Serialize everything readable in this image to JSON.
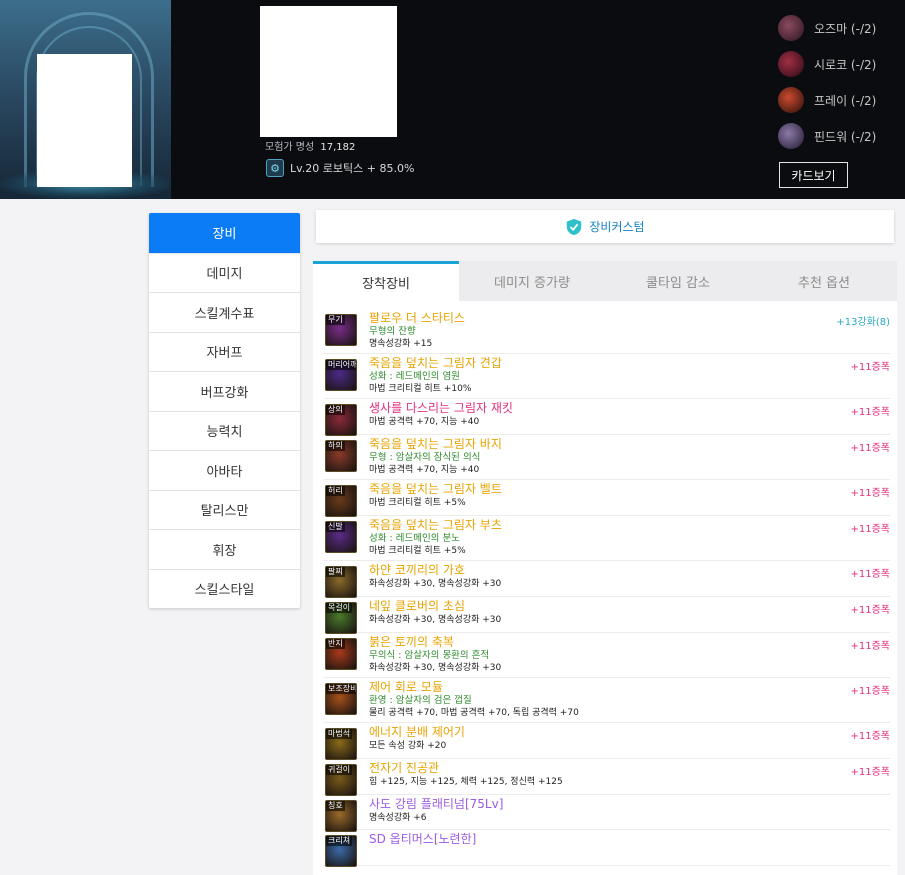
{
  "header": {
    "fame_label": "모험가 명성",
    "fame_value": "17,182",
    "guild_text": "Lv.20 로보틱스 + 85.0%",
    "party": [
      {
        "name": "오즈마 (-/2)",
        "color": "#5a2e3e"
      },
      {
        "name": "시로코 (-/2)",
        "color": "#6a1f2c"
      },
      {
        "name": "프레이 (-/2)",
        "color": "#8a2a1f"
      },
      {
        "name": "핀드워 (-/2)",
        "color": "#5a4a6a"
      }
    ],
    "card_button": "카드보기"
  },
  "menu": {
    "items": [
      "장비",
      "데미지",
      "스킬계수표",
      "자버프",
      "버프강화",
      "능력치",
      "아바타",
      "탈리스만",
      "휘장",
      "스킬스타일"
    ]
  },
  "custom": {
    "label": "장비커스텀"
  },
  "tabs": [
    "장착장비",
    "데미지 증가량",
    "쿨타임 감소",
    "추천 옵션"
  ],
  "equipment": [
    {
      "slot": "무기",
      "name": "팔로우 더 스타티스",
      "name_color": "#e8a300",
      "sub": "무형의 잔향",
      "stats": "명속성강화 +15",
      "reinforce": "+13강화(8)",
      "reinforce_color": "#2aa7c9",
      "icon_color": "#7a2d8a",
      "height": 45
    },
    {
      "slot": "머리어깨",
      "name": "죽음을 덮치는 그림자 견갑",
      "name_color": "#e8a300",
      "sub": "성화 : 레드메인의 염원",
      "stats": "마법 크리티컬 히트 +10%",
      "reinforce": "+11증폭",
      "reinforce_color": "#e0307f",
      "icon_color": "#4b2a8a",
      "height": 45
    },
    {
      "slot": "상의",
      "name": "생사를 다스리는 그림자 재킷",
      "name_color": "#e0307f",
      "sub": "",
      "stats": "마법 공격력 +70, 지능 +40",
      "reinforce": "+11증폭",
      "reinforce_color": "#e0307f",
      "icon_color": "#8a2a3a",
      "height": 36
    },
    {
      "slot": "하의",
      "name": "죽음을 덮치는 그림자 바지",
      "name_color": "#e8a300",
      "sub": "무형 : 암살자의 잠식된 의식",
      "stats": "마법 공격력 +70, 지능 +40",
      "reinforce": "+11증폭",
      "reinforce_color": "#e0307f",
      "icon_color": "#8a3a2a",
      "height": 45
    },
    {
      "slot": "허리",
      "name": "죽음을 덮치는 그림자 벨트",
      "name_color": "#e8a300",
      "sub": "",
      "stats": "마법 크리티컬 히트 +5%",
      "reinforce": "+11증폭",
      "reinforce_color": "#e0307f",
      "icon_color": "#6a3a1a",
      "height": 36
    },
    {
      "slot": "신발",
      "name": "죽음을 덮치는 그림자 부츠",
      "name_color": "#e8a300",
      "sub": "성화 : 레드메인의 분노",
      "stats": "마법 크리티컬 히트 +5%",
      "reinforce": "+11증폭",
      "reinforce_color": "#e0307f",
      "icon_color": "#5a2a8a",
      "height": 45
    },
    {
      "slot": "팔찌",
      "name": "하얀 코끼리의 가호",
      "name_color": "#e8a300",
      "sub": "",
      "stats": "화속성강화 +30, 명속성강화 +30",
      "reinforce": "+11증폭",
      "reinforce_color": "#e0307f",
      "icon_color": "#8a6a2a",
      "height": 36
    },
    {
      "slot": "목걸이",
      "name": "네잎 클로버의 초심",
      "name_color": "#e8a300",
      "sub": "",
      "stats": "화속성강화 +30, 명속성강화 +30",
      "reinforce": "+11증폭",
      "reinforce_color": "#e0307f",
      "icon_color": "#4a7a2a",
      "height": 36
    },
    {
      "slot": "반지",
      "name": "붉은 토끼의 축복",
      "name_color": "#e8a300",
      "sub": "무의식 : 암살자의 몽환의 흔적",
      "stats": "화속성강화 +30, 명속성강화 +30",
      "reinforce": "+11증폭",
      "reinforce_color": "#e0307f",
      "icon_color": "#a83a1a",
      "height": 45
    },
    {
      "slot": "보조장비",
      "name": "제어 회로 모듈",
      "name_color": "#e8a300",
      "sub": "환영 : 암살자의 검은 껍질",
      "stats": "물리 공격력 +70, 마법 공격력 +70, 독립 공격력 +70",
      "reinforce": "+11증폭",
      "reinforce_color": "#e0307f",
      "icon_color": "#a8501a",
      "height": 45
    },
    {
      "slot": "마법석",
      "name": "에너지 분배 제어기",
      "name_color": "#e8a300",
      "sub": "",
      "stats": "모든 속성 강화 +20",
      "reinforce": "+11증폭",
      "reinforce_color": "#e0307f",
      "icon_color": "#8a6a1a",
      "height": 36
    },
    {
      "slot": "귀걸이",
      "name": "전자기 진공관",
      "name_color": "#e8a300",
      "sub": "",
      "stats": "힘 +125, 지능 +125, 체력 +125, 정신력 +125",
      "reinforce": "+11증폭",
      "reinforce_color": "#e0307f",
      "icon_color": "#7a5a1a",
      "height": 36
    },
    {
      "slot": "칭호",
      "name": "사도 강림 플래티넘[75Lv]",
      "name_color": "#9b5ce0",
      "sub": "",
      "stats": "명속성강화 +6",
      "reinforce": "",
      "reinforce_color": "#e0307f",
      "icon_color": "#9a6a2a",
      "height": 35
    },
    {
      "slot": "크리쳐",
      "name": "SD 옵티머스[노련한]",
      "name_color": "#9b5ce0",
      "sub": "",
      "stats": "",
      "reinforce": "",
      "reinforce_color": "#e0307f",
      "icon_color": "#3a6aa8",
      "height": 36
    }
  ]
}
